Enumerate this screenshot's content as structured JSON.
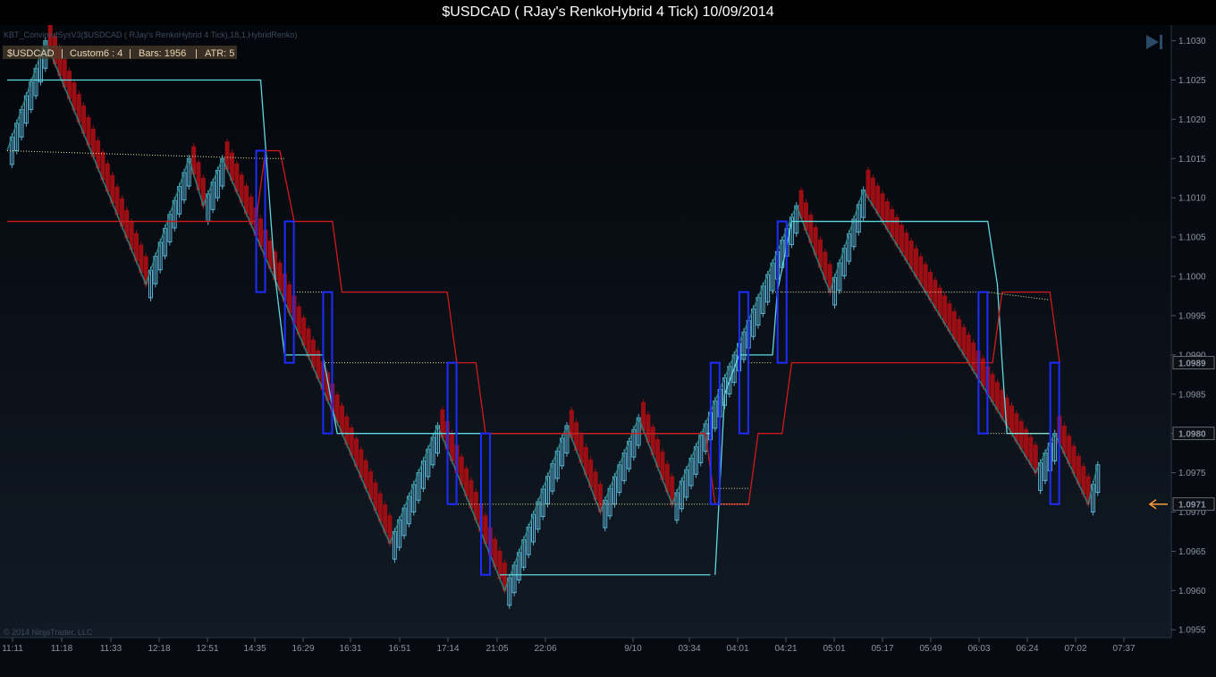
{
  "window": {
    "title": "$USDCAD ( RJay's RenkoHybrid  4 Tick)  10/09/2014"
  },
  "indicator_label": "KBT_ConvinedSysV3($USDCAD ( RJay's RenkoHybrid  4 Tick),18,1,HybridRenko)",
  "info_bar": {
    "symbol": "$USDCAD",
    "custom": "Custom6 : 4",
    "bars": "Bars:  1956",
    "atr": "ATR: 5"
  },
  "copyright": "© 2014 NinjaTrader, LLC",
  "colors": {
    "background_top": "#03060b",
    "background_bottom": "#111a24",
    "bull": "#5ab3d6",
    "bear": "#9a0e14",
    "trend_line": "#2b8a86",
    "upper_band": "#5fd8e0",
    "lower_band": "#d11a1a",
    "entry_box": "#1f2cff",
    "dotted": "#f2e6a0",
    "arrow": "#ff9a3c"
  },
  "chart_data": {
    "type": "candlestick",
    "description": "Renko-hybrid price chart with trailing bands and entry boxes",
    "ylim": [
      1.0954,
      1.1032
    ],
    "y_ticks": [
      "1.1030",
      "1.1025",
      "1.1020",
      "1.1015",
      "1.1010",
      "1.1005",
      "1.1000",
      "1.0995",
      "1.0990",
      "1.0985",
      "1.0980",
      "1.0975",
      "1.0970",
      "1.0965",
      "1.0960",
      "1.0955"
    ],
    "x_ticks": [
      "11:11",
      "11:18",
      "11:33",
      "12:18",
      "12:51",
      "14:35",
      "16:29",
      "16:31",
      "16:51",
      "17:14",
      "21:05",
      "22:06",
      "9/10",
      "03:34",
      "04:01",
      "04:21",
      "05:01",
      "05:17",
      "05:49",
      "06:03",
      "06:24",
      "07:02",
      "07:37"
    ],
    "price_labels": [
      {
        "value": "1.0989",
        "type": "white"
      },
      {
        "value": "1.0980",
        "type": "white"
      },
      {
        "value": "1.0971",
        "type": "current"
      }
    ],
    "waypoints": [
      {
        "bar": 0,
        "price": 1.1016
      },
      {
        "bar": 8,
        "price": 1.103
      },
      {
        "bar": 29,
        "price": 1.0999
      },
      {
        "bar": 38,
        "price": 1.1015
      },
      {
        "bar": 41,
        "price": 1.1009
      },
      {
        "bar": 45,
        "price": 1.1015
      },
      {
        "bar": 80,
        "price": 1.0966
      },
      {
        "bar": 90,
        "price": 1.0981
      },
      {
        "bar": 104,
        "price": 1.096
      },
      {
        "bar": 117,
        "price": 1.0981
      },
      {
        "bar": 124,
        "price": 1.097
      },
      {
        "bar": 132,
        "price": 1.0982
      },
      {
        "bar": 139,
        "price": 1.0971
      },
      {
        "bar": 165,
        "price": 1.1009
      },
      {
        "bar": 172,
        "price": 1.0998
      },
      {
        "bar": 179,
        "price": 1.1011
      },
      {
        "bar": 215,
        "price": 1.0975
      },
      {
        "bar": 219,
        "price": 1.098
      },
      {
        "bar": 226,
        "price": 1.0971
      },
      {
        "bar": 228,
        "price": 1.0976
      }
    ],
    "upper_band": [
      [
        0,
        1.1025
      ],
      [
        52,
        1.1025
      ],
      [
        55,
        1.1
      ],
      [
        59,
        1.099
      ],
      [
        62,
        1.099
      ],
      [
        66,
        1.099
      ],
      [
        69,
        1.098
      ],
      [
        145,
        1.098
      ],
      [
        148,
        1.0962
      ],
      [
        145,
        1.0962
      ]
    ],
    "upper_band_segments": [
      [
        [
          0,
          1.1025
        ],
        [
          53,
          1.1025
        ],
        [
          56,
          1.1
        ],
        [
          58,
          1.099
        ],
        [
          66,
          1.099
        ],
        [
          69,
          1.098
        ],
        [
          147,
          1.098
        ]
      ],
      [
        [
          103,
          1.0962
        ],
        [
          147,
          1.0962
        ]
      ],
      [
        [
          148,
          1.0962
        ],
        [
          150,
          1.0985
        ],
        [
          153,
          1.099
        ],
        [
          160,
          1.099
        ],
        [
          161,
          1.0998
        ],
        [
          164,
          1.1007
        ],
        [
          205,
          1.1007
        ],
        [
          207,
          1.0999
        ],
        [
          208,
          1.0989
        ],
        [
          209,
          1.098
        ],
        [
          218,
          1.098
        ]
      ]
    ],
    "lower_band_segments": [
      [
        [
          0,
          1.1007
        ],
        [
          52,
          1.1007
        ],
        [
          54,
          1.1016
        ],
        [
          57,
          1.1016
        ],
        [
          60,
          1.1007
        ],
        [
          68,
          1.1007
        ],
        [
          70,
          1.0998
        ],
        [
          92,
          1.0998
        ],
        [
          94,
          1.0989
        ],
        [
          98,
          1.0989
        ],
        [
          100,
          1.098
        ],
        [
          146,
          1.098
        ],
        [
          148,
          1.0971
        ],
        [
          155,
          1.0971
        ],
        [
          157,
          1.098
        ],
        [
          162,
          1.098
        ],
        [
          164,
          1.0989
        ],
        [
          206,
          1.0989
        ],
        [
          208,
          1.0998
        ],
        [
          217,
          1.0998
        ],
        [
          218,
          1.0998
        ],
        [
          220,
          1.0989
        ]
      ]
    ],
    "dotted_segments": [
      [
        [
          0,
          1.1016
        ],
        [
          54,
          1.1015
        ],
        [
          58,
          1.1015
        ]
      ],
      [
        [
          60,
          1.0998
        ],
        [
          66,
          1.0998
        ]
      ],
      [
        [
          66,
          1.0989
        ],
        [
          92,
          1.0989
        ]
      ],
      [
        [
          92,
          1.0971
        ],
        [
          155,
          1.0971
        ]
      ],
      [
        [
          148,
          1.0973
        ],
        [
          155,
          1.0973
        ]
      ],
      [
        [
          155,
          1.0989
        ],
        [
          160,
          1.0989
        ]
      ],
      [
        [
          160,
          1.0998
        ],
        [
          162,
          1.0998
        ]
      ],
      [
        [
          162,
          1.0998
        ],
        [
          205,
          1.0998
        ],
        [
          218,
          1.0997
        ]
      ],
      [
        [
          205,
          1.098
        ],
        [
          218,
          1.098
        ]
      ]
    ],
    "entry_boxes": [
      {
        "bar": 53,
        "top": 1.1016,
        "bottom": 1.0998
      },
      {
        "bar": 59,
        "top": 1.1007,
        "bottom": 1.0989
      },
      {
        "bar": 67,
        "top": 1.0998,
        "bottom": 1.098
      },
      {
        "bar": 93,
        "top": 1.0989,
        "bottom": 1.0971
      },
      {
        "bar": 100,
        "top": 1.098,
        "bottom": 1.0962
      },
      {
        "bar": 148,
        "top": 1.0989,
        "bottom": 1.0971
      },
      {
        "bar": 154,
        "top": 1.0998,
        "bottom": 1.098
      },
      {
        "bar": 162,
        "top": 1.1007,
        "bottom": 1.0989
      },
      {
        "bar": 204,
        "top": 1.0998,
        "bottom": 1.098
      },
      {
        "bar": 219,
        "top": 1.0989,
        "bottom": 1.0971
      }
    ]
  }
}
